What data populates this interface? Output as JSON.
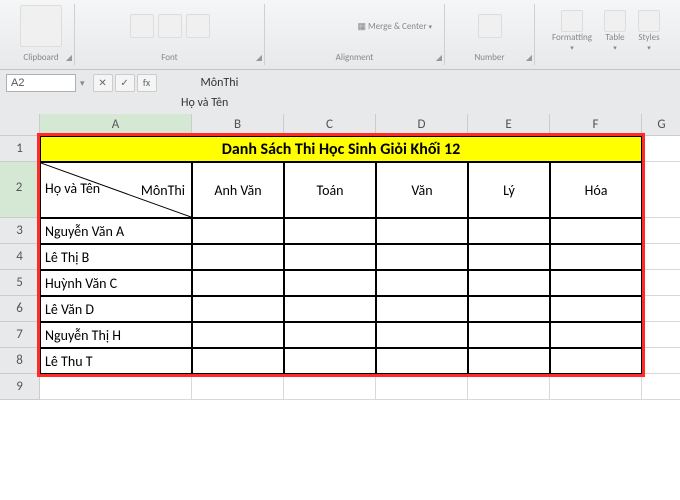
{
  "ribbon": {
    "groups": {
      "clipboard": "Clipboard",
      "font": "Font",
      "alignment": "Alignment",
      "number": "Number",
      "mergeCenter": "Merge & Center"
    },
    "right": {
      "formatting": "Formatting",
      "table": "Table",
      "styles": "Styles",
      "stylesLabel": "Styles"
    }
  },
  "formulaBar": {
    "cellRef": "A2",
    "line1": "MônThi",
    "line2": "Họ và Tên"
  },
  "columns": [
    "A",
    "B",
    "C",
    "D",
    "E",
    "F",
    "G"
  ],
  "rowNums": [
    "1",
    "2",
    "3",
    "4",
    "5",
    "6",
    "7",
    "8",
    "9"
  ],
  "table": {
    "title": "Danh Sách Thi Học Sinh Giỏi Khối 12",
    "diagTop": "MônThi",
    "diagBottom": "Họ và Tên",
    "headers": [
      "Anh Văn",
      "Toán",
      "Văn",
      "Lý",
      "Hóa"
    ],
    "students": [
      "Nguyễn Văn A",
      "Lê Thị B",
      "Huỳnh Văn C",
      "Lê Văn D",
      "Nguyễn Thị H",
      "Lê Thu T"
    ]
  }
}
